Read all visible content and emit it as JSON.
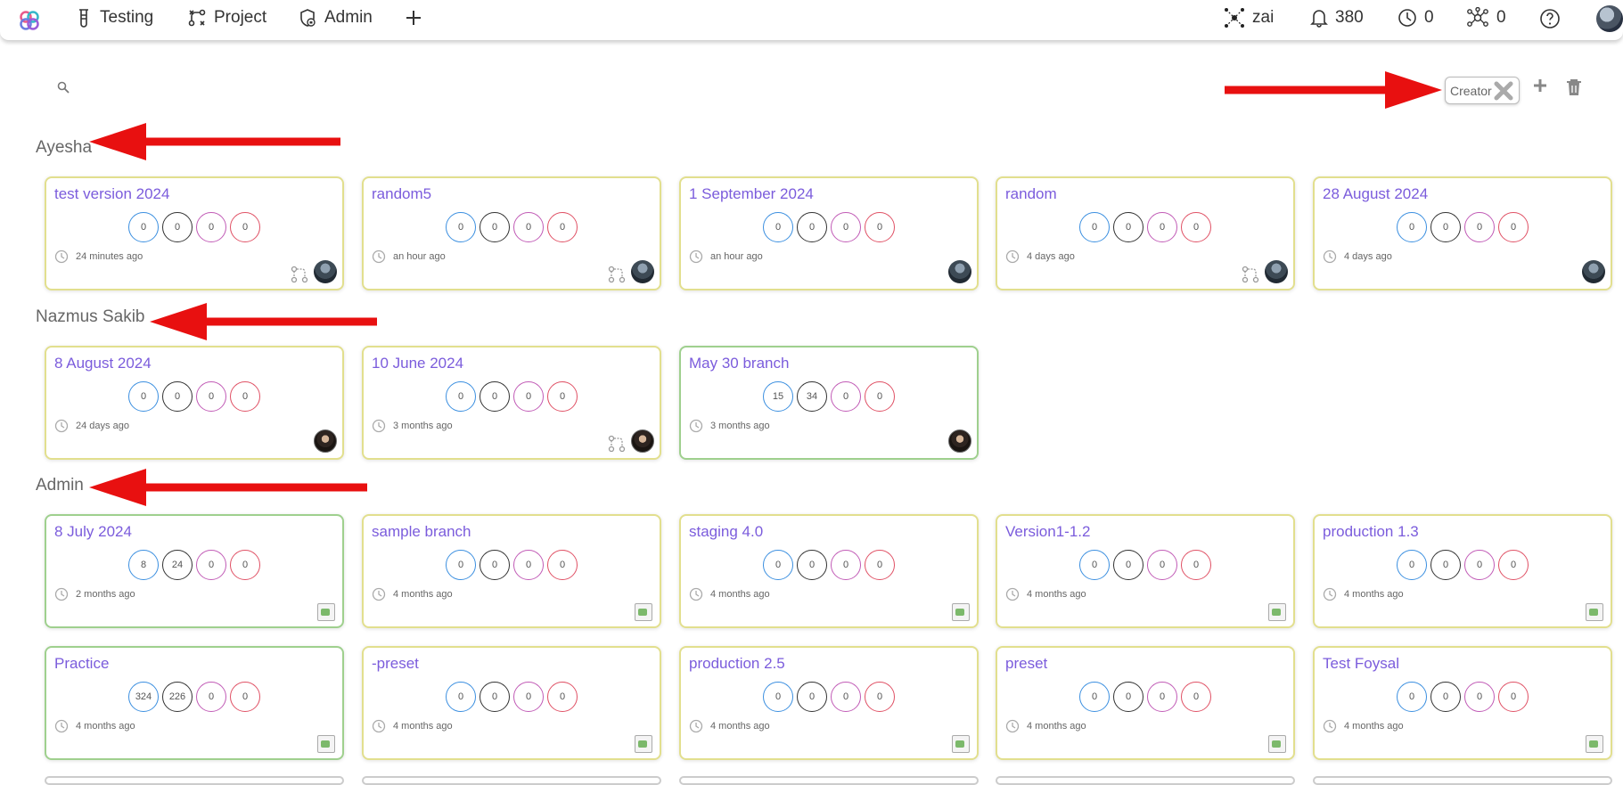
{
  "nav": {
    "testing": "Testing",
    "project": "Project",
    "admin": "Admin"
  },
  "status": {
    "workspace": "zai",
    "notifications": "380",
    "pending": "0",
    "network": "0"
  },
  "toolbar": {
    "filter_chip": "Creator"
  },
  "groups": [
    {
      "title": "Ayesha",
      "cards": [
        {
          "title": "test version 2024",
          "counts": [
            "0",
            "0",
            "0",
            "0"
          ],
          "time": "24 minutes ago",
          "branch": true,
          "avatar": "photo",
          "border": "yellow"
        },
        {
          "title": "random5",
          "counts": [
            "0",
            "0",
            "0",
            "0"
          ],
          "time": "an hour ago",
          "branch": true,
          "avatar": "photo",
          "border": "yellow"
        },
        {
          "title": "1 September 2024",
          "counts": [
            "0",
            "0",
            "0",
            "0"
          ],
          "time": "an hour ago",
          "branch": false,
          "avatar": "photo",
          "border": "yellow"
        },
        {
          "title": "random",
          "counts": [
            "0",
            "0",
            "0",
            "0"
          ],
          "time": "4 days ago",
          "branch": true,
          "avatar": "photo",
          "border": "yellow"
        },
        {
          "title": "28 August 2024",
          "counts": [
            "0",
            "0",
            "0",
            "0"
          ],
          "time": "4 days ago",
          "branch": false,
          "avatar": "photo",
          "border": "yellow"
        }
      ]
    },
    {
      "title": "Nazmus Sakib",
      "cards": [
        {
          "title": "8 August 2024",
          "counts": [
            "0",
            "0",
            "0",
            "0"
          ],
          "time": "24 days ago",
          "branch": false,
          "avatar": "person",
          "border": "yellow"
        },
        {
          "title": "10 June 2024",
          "counts": [
            "0",
            "0",
            "0",
            "0"
          ],
          "time": "3 months ago",
          "branch": true,
          "avatar": "person",
          "border": "yellow"
        },
        {
          "title": "May 30 branch",
          "counts": [
            "15",
            "34",
            "0",
            "0"
          ],
          "time": "3 months ago",
          "branch": false,
          "avatar": "person",
          "border": "green"
        }
      ]
    },
    {
      "title": "Admin",
      "cards": [
        {
          "title": "8 July 2024",
          "counts": [
            "8",
            "24",
            "0",
            "0"
          ],
          "time": "2 months ago",
          "branch": false,
          "avatar": "broken",
          "border": "green"
        },
        {
          "title": "sample branch",
          "counts": [
            "0",
            "0",
            "0",
            "0"
          ],
          "time": "4 months ago",
          "branch": false,
          "avatar": "broken",
          "border": "yellow"
        },
        {
          "title": "staging 4.0",
          "counts": [
            "0",
            "0",
            "0",
            "0"
          ],
          "time": "4 months ago",
          "branch": false,
          "avatar": "broken",
          "border": "yellow"
        },
        {
          "title": "Version1-1.2",
          "counts": [
            "0",
            "0",
            "0",
            "0"
          ],
          "time": "4 months ago",
          "branch": false,
          "avatar": "broken",
          "border": "yellow"
        },
        {
          "title": "production 1.3",
          "counts": [
            "0",
            "0",
            "0",
            "0"
          ],
          "time": "4 months ago",
          "branch": false,
          "avatar": "broken",
          "border": "yellow"
        },
        {
          "title": "Practice",
          "counts": [
            "324",
            "226",
            "0",
            "0"
          ],
          "time": "4 months ago",
          "branch": false,
          "avatar": "broken",
          "border": "green"
        },
        {
          "title": "-preset",
          "counts": [
            "0",
            "0",
            "0",
            "0"
          ],
          "time": "4 months ago",
          "branch": false,
          "avatar": "broken",
          "border": "yellow"
        },
        {
          "title": "production 2.5",
          "counts": [
            "0",
            "0",
            "0",
            "0"
          ],
          "time": "4 months ago",
          "branch": false,
          "avatar": "broken",
          "border": "yellow"
        },
        {
          "title": "preset",
          "counts": [
            "0",
            "0",
            "0",
            "0"
          ],
          "time": "4 months ago",
          "branch": false,
          "avatar": "broken",
          "border": "yellow"
        },
        {
          "title": "Test Foysal",
          "counts": [
            "0",
            "0",
            "0",
            "0"
          ],
          "time": "4 months ago",
          "branch": false,
          "avatar": "broken",
          "border": "yellow"
        }
      ]
    }
  ],
  "colors": {
    "card_title": "#7b5cdc",
    "annotation_arrow": "#e81010",
    "circle_blue": "#3b8fe0",
    "circle_black": "#333333",
    "circle_purple": "#c15bb6",
    "circle_red": "#e05165"
  }
}
